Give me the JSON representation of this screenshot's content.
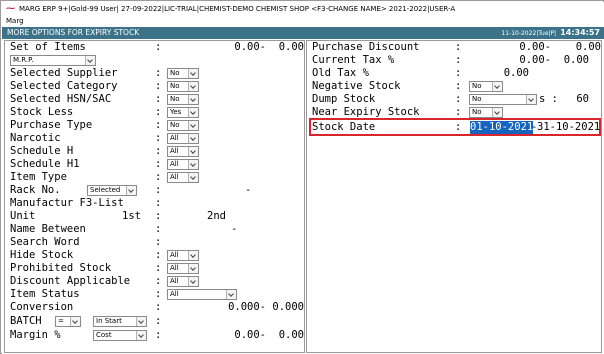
{
  "titlebar": {
    "logo": "⁓",
    "title": "MARG ERP 9+|Gold-99 User| 27-09-2022|LIC-TRIAL|CHEMIST-DEMO CHEMIST SHOP <F3-CHANGE NAME> 2021-2022|USER-A"
  },
  "menubar": {
    "label": "Marg"
  },
  "header": {
    "title": "MORE OPTIONS FOR EXPIRY STOCK",
    "date": "11-10-2022|Tue|P|",
    "time": "14:34:57"
  },
  "left": {
    "set_of_items": {
      "label": "Set of Items",
      "colon": ":",
      "v1": "0.00-",
      "v2": "0.00",
      "dropdown": "M.R.P."
    },
    "selected_supplier": {
      "label": "Selected Supplier",
      "colon": ":",
      "dropdown": "No"
    },
    "selected_category": {
      "label": "Selected Category",
      "colon": ":",
      "dropdown": "No"
    },
    "selected_hsn": {
      "label": "Selected HSN/SAC",
      "colon": ":",
      "dropdown": "No"
    },
    "stock_less": {
      "label": "Stock Less",
      "colon": ":",
      "dropdown": "Yes"
    },
    "purchase_type": {
      "label": "Purchase Type",
      "colon": ":",
      "dropdown": "No"
    },
    "narcotic": {
      "label": "Narcotic",
      "colon": ":",
      "dropdown": "All"
    },
    "schedule_h": {
      "label": "Schedule H",
      "colon": ":",
      "dropdown": "All"
    },
    "schedule_h1": {
      "label": "Schedule H1",
      "colon": ":",
      "dropdown": "All"
    },
    "item_type": {
      "label": "Item Type",
      "colon": ":",
      "dropdown": "All"
    },
    "rack_no": {
      "label": "Rack No.",
      "colon": ":",
      "dropdown": "Selected",
      "dash": "-"
    },
    "manufactur": {
      "label": "Manufactur F3-List",
      "colon": ":"
    },
    "unit": {
      "label": "Unit",
      "v1": "1st",
      "colon": ":",
      "v2": "2nd"
    },
    "name_between": {
      "label": "Name Between",
      "colon": ":",
      "dash": "-"
    },
    "search_word": {
      "label": "Search Word",
      "colon": ":"
    },
    "hide_stock": {
      "label": "Hide Stock",
      "colon": ":",
      "dropdown": "All"
    },
    "prohibited_stock": {
      "label": "Prohibited Stock",
      "colon": ":",
      "dropdown": "All"
    },
    "discount_applicable": {
      "label": "Discount Applicable",
      "colon": ":",
      "dropdown": "All"
    },
    "item_status": {
      "label": "Item Status",
      "colon": ":",
      "dropdown": "All"
    },
    "conversion": {
      "label": "Conversion",
      "colon": ":",
      "v1": "0.000-",
      "v2": "0.000"
    },
    "batch": {
      "label": "BATCH",
      "op": "=",
      "dropdown": "In Start",
      "colon": ":"
    },
    "margin": {
      "label": "Margin %",
      "dropdown": "Cost",
      "colon": ":",
      "v1": "0.00-",
      "v2": "0.00"
    }
  },
  "right": {
    "purchase_discount": {
      "label": "Purchase Discount",
      "colon": ":",
      "v1": "0.00-",
      "v2": "0.00"
    },
    "current_tax": {
      "label": "Current Tax %",
      "colon": ":",
      "v1": "0.00-",
      "v2": "0.00"
    },
    "old_tax": {
      "label": "Old Tax %",
      "colon": ":",
      "v1": "0.00"
    },
    "negative_stock": {
      "label": "Negative Stock",
      "colon": ":",
      "dropdown": "No"
    },
    "dump_stock": {
      "label": "Dump Stock",
      "colon": ":",
      "dropdown": "No",
      "suffix": "s :",
      "days": "60"
    },
    "near_expiry": {
      "label": "Near Expiry Stock",
      "colon": ":",
      "dropdown": "No"
    },
    "stock_date": {
      "label": "Stock Date",
      "colon": ":",
      "from": "01-10-2021",
      "sep": "-",
      "to": "31-10-2021"
    }
  }
}
